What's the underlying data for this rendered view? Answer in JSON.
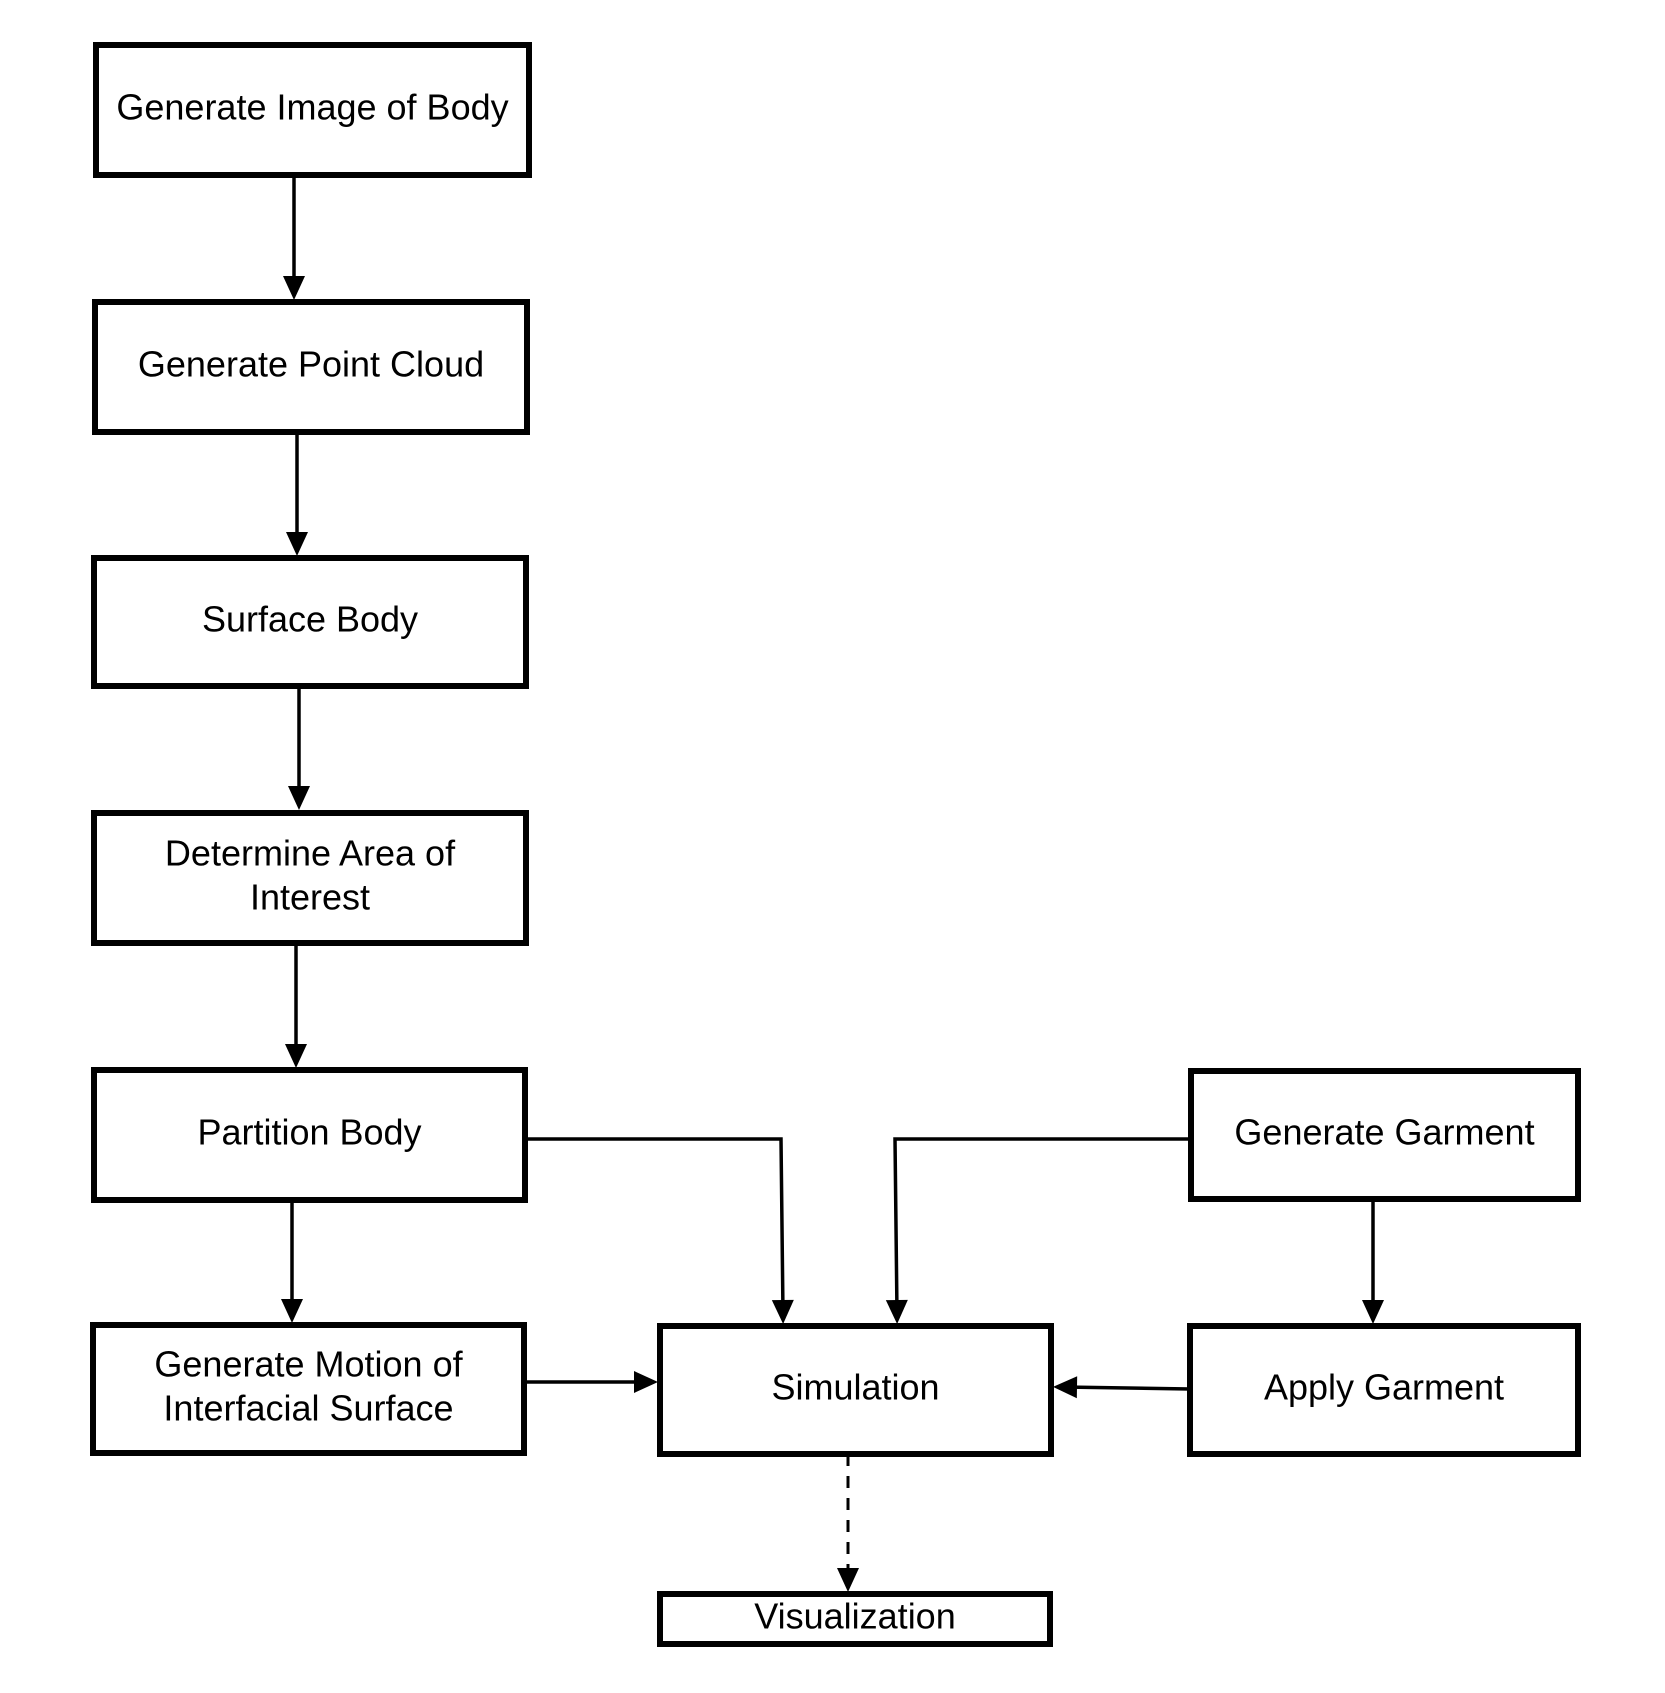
{
  "diagram": {
    "type": "flowchart",
    "nodes": [
      {
        "id": "generate_image",
        "label": [
          "Generate Image of Body"
        ]
      },
      {
        "id": "point_cloud",
        "label": [
          "Generate Point Cloud"
        ]
      },
      {
        "id": "surface_body",
        "label": [
          "Surface Body"
        ]
      },
      {
        "id": "area_interest",
        "label": [
          "Determine Area of",
          "Interest"
        ]
      },
      {
        "id": "partition_body",
        "label": [
          "Partition Body"
        ]
      },
      {
        "id": "motion_surface",
        "label": [
          "Generate Motion of",
          "Interfacial Surface"
        ]
      },
      {
        "id": "simulation",
        "label": [
          "Simulation"
        ]
      },
      {
        "id": "generate_garment",
        "label": [
          "Generate Garment"
        ]
      },
      {
        "id": "apply_garment",
        "label": [
          "Apply Garment"
        ]
      },
      {
        "id": "visualization",
        "label": [
          "Visualization"
        ]
      }
    ],
    "edges": [
      {
        "from": "generate_image",
        "to": "point_cloud",
        "style": "solid"
      },
      {
        "from": "point_cloud",
        "to": "surface_body",
        "style": "solid"
      },
      {
        "from": "surface_body",
        "to": "area_interest",
        "style": "solid"
      },
      {
        "from": "area_interest",
        "to": "partition_body",
        "style": "solid"
      },
      {
        "from": "partition_body",
        "to": "motion_surface",
        "style": "solid"
      },
      {
        "from": "partition_body",
        "to": "simulation",
        "style": "solid"
      },
      {
        "from": "generate_garment",
        "to": "simulation",
        "style": "solid"
      },
      {
        "from": "generate_garment",
        "to": "apply_garment",
        "style": "solid"
      },
      {
        "from": "motion_surface",
        "to": "simulation",
        "style": "solid"
      },
      {
        "from": "apply_garment",
        "to": "simulation",
        "style": "solid"
      },
      {
        "from": "simulation",
        "to": "visualization",
        "style": "dashed"
      }
    ]
  }
}
